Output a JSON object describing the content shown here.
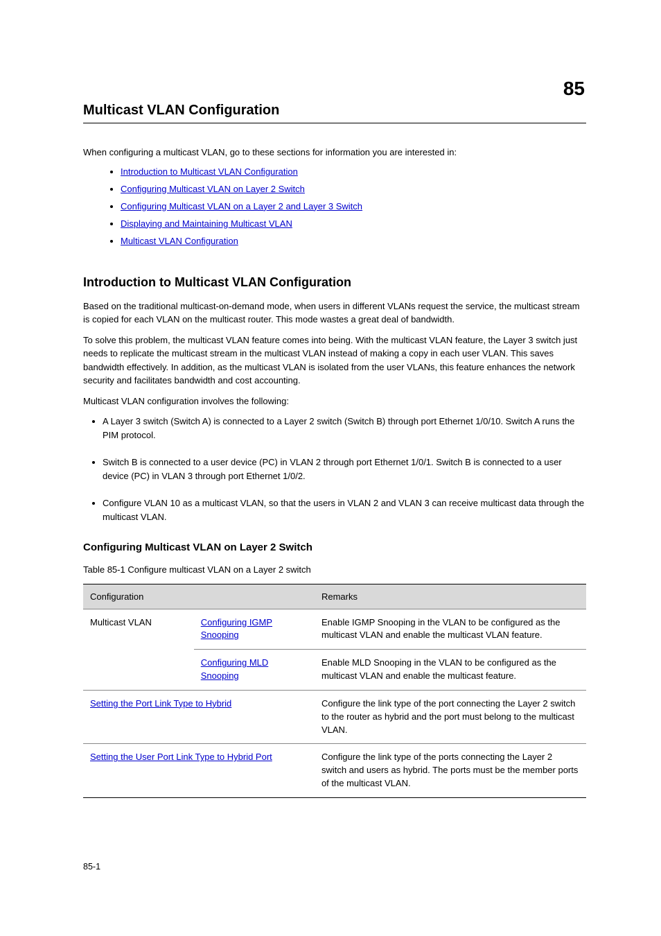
{
  "chapter_number": "85",
  "chapter_title": "Multicast VLAN Configuration",
  "intro": "When configuring a multicast VLAN, go to these sections for information you are interested in:",
  "toc_links": [
    "Introduction to Multicast VLAN Configuration",
    "Configuring Multicast VLAN on Layer 2 Switch",
    "Configuring Multicast VLAN on a Layer 2 and Layer 3 Switch",
    "Displaying and Maintaining Multicast VLAN",
    "Multicast VLAN Configuration"
  ],
  "section1": {
    "heading": "Introduction to Multicast VLAN Configuration",
    "p1": "Based on the traditional multicast-on-demand mode, when users in different VLANs request the service, the multicast stream is copied for each VLAN on the multicast router. This mode wastes a great deal of bandwidth.",
    "p2": "To solve this problem, the multicast VLAN feature comes into being. With the multicast VLAN feature, the Layer 3 switch just needs to replicate the multicast stream in the multicast VLAN instead of making a copy in each user VLAN. This saves bandwidth effectively. In addition, as the multicast VLAN is isolated from the user VLANs, this feature enhances the network security and facilitates bandwidth and cost accounting.",
    "p3": "Multicast VLAN configuration involves the following:"
  },
  "bulleted": [
    "A Layer 3 switch (Switch A) is connected to a Layer 2 switch (Switch B) through port Ethernet 1/0/10. Switch A runs the PIM protocol.",
    "Switch B is connected to a user device (PC) in VLAN 2 through port Ethernet 1/0/1. Switch B is connected to a user device (PC) in VLAN 3 through port Ethernet 1/0/2.",
    "Configure VLAN 10 as a multicast VLAN, so that the users in VLAN 2 and VLAN 3 can receive multicast data through the multicast VLAN."
  ],
  "section2": {
    "heading": "Configuring Multicast VLAN on Layer 2 Switch",
    "table_caption": "Table 85-1 Configure multicast VLAN on a Layer 2 switch"
  },
  "table": {
    "headers": [
      "Configuration",
      "Remarks"
    ],
    "rows": [
      {
        "c1": "Multicast VLAN",
        "c2_link": "Configuring IGMP Snooping",
        "c2_rest": "",
        "c3": "Enable IGMP Snooping in the VLAN to be configured as the multicast VLAN and enable the multicast VLAN feature."
      },
      {
        "c1": "",
        "c2_link": "Configuring MLD Snooping",
        "c2_rest": "",
        "c3": "Enable MLD Snooping in the VLAN to be configured as the multicast VLAN and enable the multicast feature."
      },
      {
        "c1_link": "Setting the Port Link Type to Hybrid",
        "c1_rest": "",
        "c3": "Configure the link type of the port connecting the Layer 2 switch to the router as hybrid and the port must belong to the multicast VLAN."
      },
      {
        "c1_link": "Setting the User Port Link Type to Hybrid Port",
        "c1_rest": "",
        "c3": "Configure the link type of the ports connecting the Layer 2 switch and users as hybrid. The ports must be the member ports of the multicast VLAN."
      }
    ]
  },
  "footer": "85-1"
}
